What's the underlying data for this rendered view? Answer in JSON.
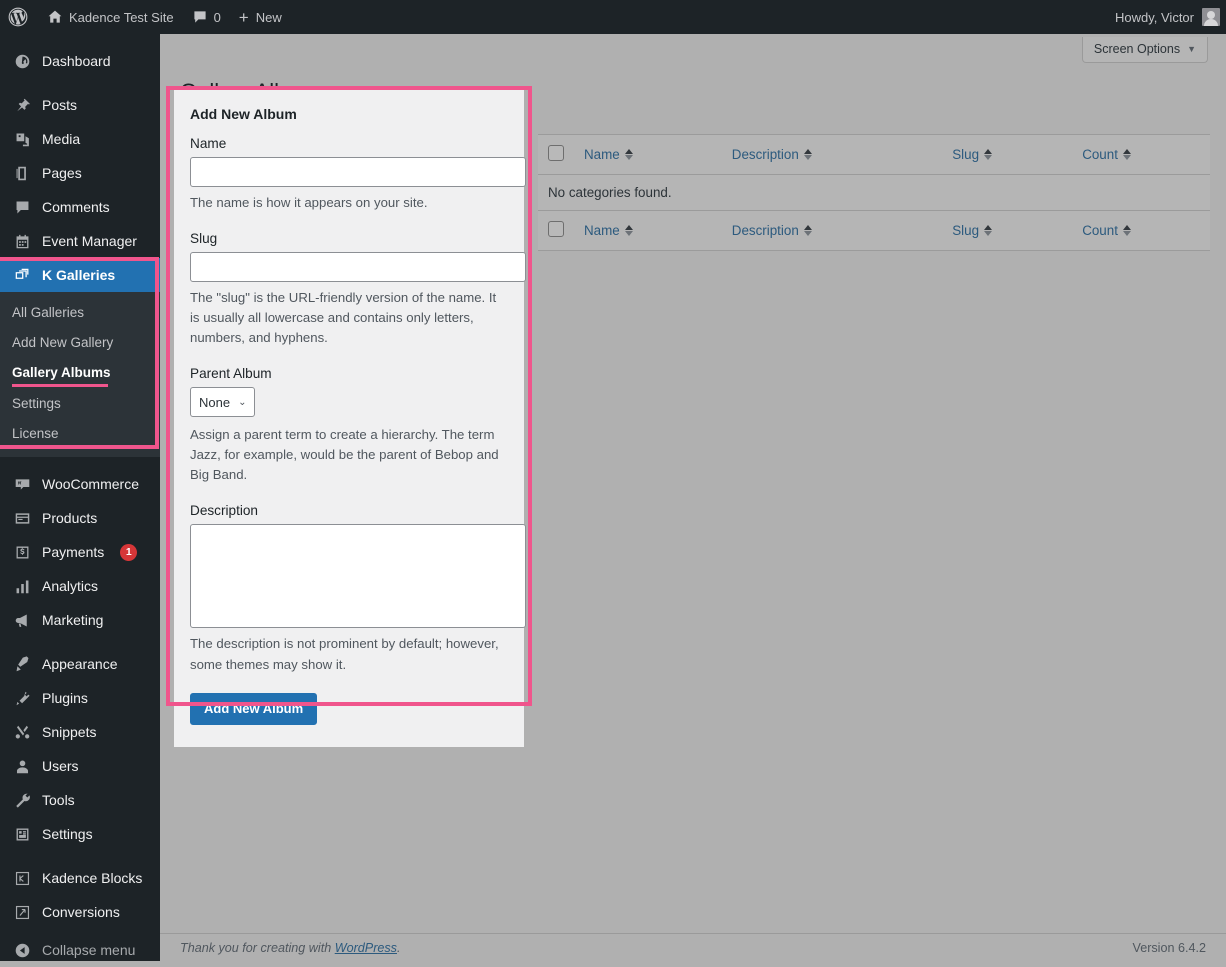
{
  "adminbar": {
    "site_name": "Kadence Test Site",
    "comment_count": "0",
    "new_label": "New",
    "howdy": "Howdy, Victor",
    "wp_logo_icon": "wordpress-logo-icon",
    "home_icon": "home-icon",
    "comment_icon": "comment-bubble-icon",
    "plus_icon": "plus-icon",
    "avatar_icon": "avatar"
  },
  "sidebar": {
    "items": [
      {
        "label": "Dashboard",
        "icon": "dashboard-icon",
        "current": false
      },
      {
        "label": "Posts",
        "icon": "pin-icon",
        "current": false
      },
      {
        "label": "Media",
        "icon": "media-icon",
        "current": false
      },
      {
        "label": "Pages",
        "icon": "pages-icon",
        "current": false
      },
      {
        "label": "Comments",
        "icon": "comments-icon",
        "current": false
      },
      {
        "label": "Event Manager",
        "icon": "calendar-icon",
        "current": false
      },
      {
        "label": "K Galleries",
        "icon": "galleries-icon",
        "current": true
      },
      {
        "label": "WooCommerce",
        "icon": "woocommerce-icon",
        "current": false
      },
      {
        "label": "Products",
        "icon": "products-icon",
        "current": false
      },
      {
        "label": "Payments",
        "icon": "payments-icon",
        "current": false,
        "badge": "1"
      },
      {
        "label": "Analytics",
        "icon": "analytics-icon",
        "current": false
      },
      {
        "label": "Marketing",
        "icon": "megaphone-icon",
        "current": false
      },
      {
        "label": "Appearance",
        "icon": "appearance-icon",
        "current": false
      },
      {
        "label": "Plugins",
        "icon": "plugins-icon",
        "current": false
      },
      {
        "label": "Snippets",
        "icon": "scissors-icon",
        "current": false
      },
      {
        "label": "Users",
        "icon": "users-icon",
        "current": false
      },
      {
        "label": "Tools",
        "icon": "wrench-icon",
        "current": false
      },
      {
        "label": "Settings",
        "icon": "settings-icon",
        "current": false
      },
      {
        "label": "Kadence Blocks",
        "icon": "kadence-blocks-icon",
        "current": false
      },
      {
        "label": "Conversions",
        "icon": "conversions-icon",
        "current": false
      }
    ],
    "submenu": [
      {
        "label": "All Galleries",
        "current": false
      },
      {
        "label": "Add New Gallery",
        "current": false
      },
      {
        "label": "Gallery Albums",
        "current": true
      },
      {
        "label": "Settings",
        "current": false
      },
      {
        "label": "License",
        "current": false
      }
    ],
    "collapse_label": "Collapse menu",
    "collapse_icon": "collapse-arrow-icon"
  },
  "screen_options": {
    "label": "Screen Options",
    "caret_icon": "chevron-down-icon"
  },
  "page": {
    "title": "Gallery Albums"
  },
  "form": {
    "heading": "Add New Album",
    "name_label": "Name",
    "name_value": "",
    "name_desc": "The name is how it appears on your site.",
    "slug_label": "Slug",
    "slug_value": "",
    "slug_desc": "The \"slug\" is the URL-friendly version of the name. It is usually all lowercase and contains only letters, numbers, and hyphens.",
    "parent_label": "Parent Album",
    "parent_value": "None",
    "parent_options": [
      "None"
    ],
    "parent_desc": "Assign a parent term to create a hierarchy. The term Jazz, for example, would be the parent of Bebop and Big Band.",
    "description_label": "Description",
    "description_value": "",
    "description_desc": "The description is not prominent by default; however, some themes may show it.",
    "submit_label": "Add New Album"
  },
  "table": {
    "columns": [
      {
        "label": "Name",
        "align": "left"
      },
      {
        "label": "Description",
        "align": "left"
      },
      {
        "label": "Slug",
        "align": "left"
      },
      {
        "label": "Count",
        "align": "right"
      }
    ],
    "empty_message": "No categories found.",
    "select_all_icon": "checkbox",
    "sort_icon": "sort-arrows-icon"
  },
  "footer": {
    "thanks_prefix": "Thank you for creating with ",
    "wordpress_link": "WordPress",
    "thanks_suffix": ".",
    "version": "Version 6.4.2"
  },
  "colors": {
    "accent_blue": "#2271b1",
    "admin_dark": "#1d2327",
    "submenu_dark": "#2c3338",
    "annotation_pink": "#f0558c",
    "badge_red": "#d63638",
    "page_bg": "#b0b0b0",
    "panel_bg": "#f0f0f1"
  }
}
